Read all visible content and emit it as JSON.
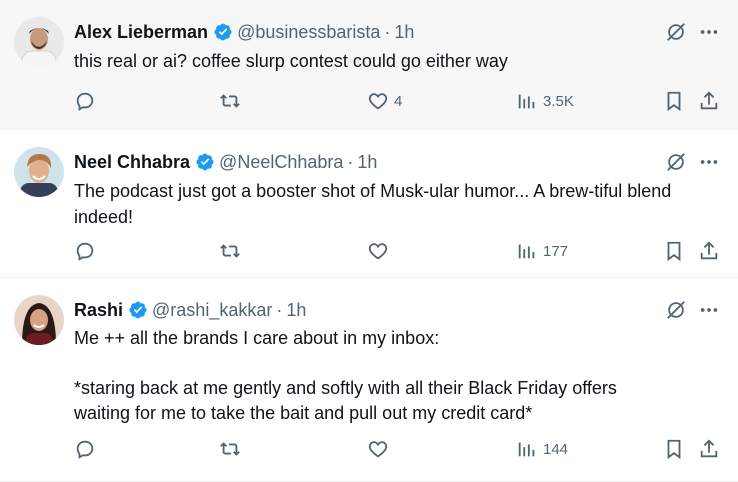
{
  "colors": {
    "text_primary": "#0f1419",
    "text_secondary": "#536471",
    "verified_blue": "#1d9bf0",
    "hover_bg": "#f7f7f7",
    "divider": "#eff3f4"
  },
  "icons": {
    "verified": "verified-badge-icon",
    "grok": "grok-icon",
    "more": "more-icon",
    "reply": "reply-icon",
    "repost": "repost-icon",
    "like": "heart-icon",
    "views": "views-bar-icon",
    "bookmark": "bookmark-icon",
    "share": "share-icon"
  },
  "tweets": [
    {
      "name": "Alex Lieberman",
      "handle": "@businessbarista",
      "separator": "·",
      "time": "1h",
      "text": "this real or ai? coffee slurp contest could go either way",
      "likes": "4",
      "views": "3.5K",
      "reposts": "",
      "replies": ""
    },
    {
      "name": "Neel Chhabra",
      "handle": "@NeelChhabra",
      "separator": "·",
      "time": "1h",
      "text": "The podcast just got a booster shot of Musk-ular humor... A brew-tiful blend indeed!",
      "likes": "",
      "views": "177",
      "reposts": "",
      "replies": ""
    },
    {
      "name": "Rashi",
      "handle": "@rashi_kakkar",
      "separator": "·",
      "time": "1h",
      "text": "Me ++ all the brands I care about in my inbox:\n\n*staring back at me gently and softly with all their Black Friday offers waiting for me to take the bait and pull out my credit card*",
      "likes": "",
      "views": "144",
      "reposts": "",
      "replies": ""
    }
  ]
}
